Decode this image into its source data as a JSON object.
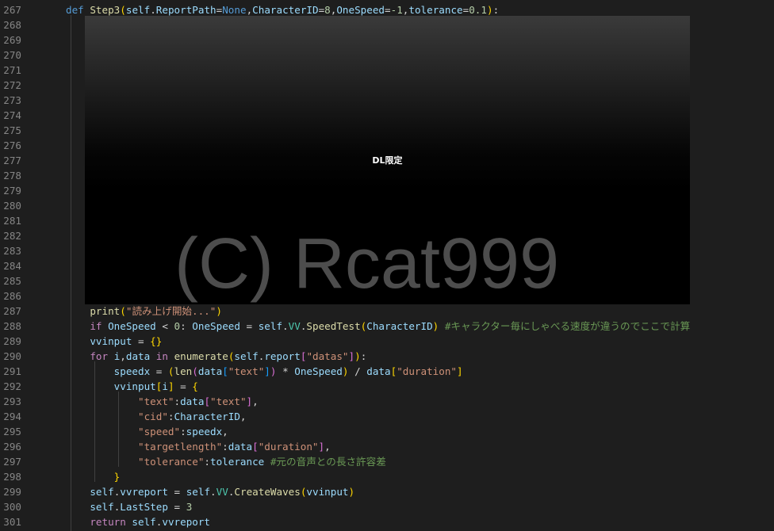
{
  "editor": {
    "lines": [
      {
        "n": "267",
        "tokens": [
          {
            "t": "def ",
            "c": "kw"
          },
          {
            "t": "Step3",
            "c": "fn"
          },
          {
            "t": "(",
            "c": "b1"
          },
          {
            "t": "self",
            "c": "var"
          },
          {
            "t": ".",
            "c": "pun"
          },
          {
            "t": "ReportPath",
            "c": "var"
          },
          {
            "t": "=",
            "c": "pun"
          },
          {
            "t": "None",
            "c": "kw"
          },
          {
            "t": ",",
            "c": "pun"
          },
          {
            "t": "CharacterID",
            "c": "var"
          },
          {
            "t": "=",
            "c": "pun"
          },
          {
            "t": "8",
            "c": "num"
          },
          {
            "t": ",",
            "c": "pun"
          },
          {
            "t": "OneSpeed",
            "c": "var"
          },
          {
            "t": "=",
            "c": "pun"
          },
          {
            "t": "-1",
            "c": "num"
          },
          {
            "t": ",",
            "c": "pun"
          },
          {
            "t": "tolerance",
            "c": "var"
          },
          {
            "t": "=",
            "c": "pun"
          },
          {
            "t": "0.1",
            "c": "num"
          },
          {
            "t": ")",
            "c": "b1"
          },
          {
            "t": ":",
            "c": "pun"
          }
        ]
      },
      {
        "n": "268",
        "tokens": []
      },
      {
        "n": "269",
        "tokens": []
      },
      {
        "n": "270",
        "tokens": []
      },
      {
        "n": "271",
        "tokens": []
      },
      {
        "n": "272",
        "tokens": []
      },
      {
        "n": "273",
        "tokens": []
      },
      {
        "n": "274",
        "tokens": []
      },
      {
        "n": "275",
        "tokens": []
      },
      {
        "n": "276",
        "tokens": []
      },
      {
        "n": "277",
        "tokens": []
      },
      {
        "n": "278",
        "tokens": []
      },
      {
        "n": "279",
        "tokens": []
      },
      {
        "n": "280",
        "tokens": []
      },
      {
        "n": "281",
        "tokens": []
      },
      {
        "n": "282",
        "tokens": []
      },
      {
        "n": "283",
        "tokens": []
      },
      {
        "n": "284",
        "tokens": []
      },
      {
        "n": "285",
        "tokens": []
      },
      {
        "n": "286",
        "tokens": []
      },
      {
        "n": "287",
        "tokens": [
          {
            "t": "    "
          },
          {
            "t": "print",
            "c": "fn"
          },
          {
            "t": "(",
            "c": "b1"
          },
          {
            "t": "\"読み上げ開始...\"",
            "c": "str"
          },
          {
            "t": ")",
            "c": "b1"
          }
        ]
      },
      {
        "n": "288",
        "tokens": [
          {
            "t": "    "
          },
          {
            "t": "if ",
            "c": "ctl"
          },
          {
            "t": "OneSpeed",
            "c": "var"
          },
          {
            "t": " < ",
            "c": "pun"
          },
          {
            "t": "0",
            "c": "num"
          },
          {
            "t": ": ",
            "c": "pun"
          },
          {
            "t": "OneSpeed",
            "c": "var"
          },
          {
            "t": " = ",
            "c": "pun"
          },
          {
            "t": "self",
            "c": "var"
          },
          {
            "t": ".",
            "c": "pun"
          },
          {
            "t": "VV",
            "c": "cls"
          },
          {
            "t": ".",
            "c": "pun"
          },
          {
            "t": "SpeedTest",
            "c": "fn"
          },
          {
            "t": "(",
            "c": "b1"
          },
          {
            "t": "CharacterID",
            "c": "var"
          },
          {
            "t": ")",
            "c": "b1"
          },
          {
            "t": " "
          },
          {
            "t": "#キャラクター毎にしゃべる速度が違うのでここで計算",
            "c": "cmt"
          }
        ]
      },
      {
        "n": "289",
        "tokens": [
          {
            "t": "    "
          },
          {
            "t": "vvinput",
            "c": "var"
          },
          {
            "t": " = ",
            "c": "pun"
          },
          {
            "t": "{}",
            "c": "b1"
          }
        ]
      },
      {
        "n": "290",
        "tokens": [
          {
            "t": "    "
          },
          {
            "t": "for ",
            "c": "ctl"
          },
          {
            "t": "i",
            "c": "var"
          },
          {
            "t": ",",
            "c": "pun"
          },
          {
            "t": "data",
            "c": "var"
          },
          {
            "t": " in ",
            "c": "ctl"
          },
          {
            "t": "enumerate",
            "c": "fn"
          },
          {
            "t": "(",
            "c": "b1"
          },
          {
            "t": "self",
            "c": "var"
          },
          {
            "t": ".",
            "c": "pun"
          },
          {
            "t": "report",
            "c": "var"
          },
          {
            "t": "[",
            "c": "b2"
          },
          {
            "t": "\"datas\"",
            "c": "str"
          },
          {
            "t": "]",
            "c": "b2"
          },
          {
            "t": ")",
            "c": "b1"
          },
          {
            "t": ":",
            "c": "pun"
          }
        ]
      },
      {
        "n": "291",
        "tokens": [
          {
            "t": "        "
          },
          {
            "t": "speedx",
            "c": "var"
          },
          {
            "t": " = ",
            "c": "pun"
          },
          {
            "t": "(",
            "c": "b1"
          },
          {
            "t": "len",
            "c": "fn"
          },
          {
            "t": "(",
            "c": "b2"
          },
          {
            "t": "data",
            "c": "var"
          },
          {
            "t": "[",
            "c": "b3"
          },
          {
            "t": "\"text\"",
            "c": "str"
          },
          {
            "t": "]",
            "c": "b3"
          },
          {
            "t": ")",
            "c": "b2"
          },
          {
            "t": " * ",
            "c": "pun"
          },
          {
            "t": "OneSpeed",
            "c": "var"
          },
          {
            "t": ")",
            "c": "b1"
          },
          {
            "t": " / ",
            "c": "pun"
          },
          {
            "t": "data",
            "c": "var"
          },
          {
            "t": "[",
            "c": "b1"
          },
          {
            "t": "\"duration\"",
            "c": "str"
          },
          {
            "t": "]",
            "c": "b1"
          }
        ]
      },
      {
        "n": "292",
        "tokens": [
          {
            "t": "        "
          },
          {
            "t": "vvinput",
            "c": "var"
          },
          {
            "t": "[",
            "c": "b1"
          },
          {
            "t": "i",
            "c": "var"
          },
          {
            "t": "]",
            "c": "b1"
          },
          {
            "t": " = ",
            "c": "pun"
          },
          {
            "t": "{",
            "c": "b1"
          }
        ]
      },
      {
        "n": "293",
        "tokens": [
          {
            "t": "            "
          },
          {
            "t": "\"text\"",
            "c": "str"
          },
          {
            "t": ":",
            "c": "pun"
          },
          {
            "t": "data",
            "c": "var"
          },
          {
            "t": "[",
            "c": "b2"
          },
          {
            "t": "\"text\"",
            "c": "str"
          },
          {
            "t": "]",
            "c": "b2"
          },
          {
            "t": ",",
            "c": "pun"
          }
        ]
      },
      {
        "n": "294",
        "tokens": [
          {
            "t": "            "
          },
          {
            "t": "\"cid\"",
            "c": "str"
          },
          {
            "t": ":",
            "c": "pun"
          },
          {
            "t": "CharacterID",
            "c": "var"
          },
          {
            "t": ",",
            "c": "pun"
          }
        ]
      },
      {
        "n": "295",
        "tokens": [
          {
            "t": "            "
          },
          {
            "t": "\"speed\"",
            "c": "str"
          },
          {
            "t": ":",
            "c": "pun"
          },
          {
            "t": "speedx",
            "c": "var"
          },
          {
            "t": ",",
            "c": "pun"
          }
        ]
      },
      {
        "n": "296",
        "tokens": [
          {
            "t": "            "
          },
          {
            "t": "\"targetlength\"",
            "c": "str"
          },
          {
            "t": ":",
            "c": "pun"
          },
          {
            "t": "data",
            "c": "var"
          },
          {
            "t": "[",
            "c": "b2"
          },
          {
            "t": "\"duration\"",
            "c": "str"
          },
          {
            "t": "]",
            "c": "b2"
          },
          {
            "t": ",",
            "c": "pun"
          }
        ]
      },
      {
        "n": "297",
        "tokens": [
          {
            "t": "            "
          },
          {
            "t": "\"tolerance\"",
            "c": "str"
          },
          {
            "t": ":",
            "c": "pun"
          },
          {
            "t": "tolerance",
            "c": "var"
          },
          {
            "t": " "
          },
          {
            "t": "#元の音声との長さ許容差",
            "c": "cmt"
          }
        ]
      },
      {
        "n": "298",
        "tokens": [
          {
            "t": "        "
          },
          {
            "t": "}",
            "c": "b1"
          }
        ]
      },
      {
        "n": "299",
        "tokens": [
          {
            "t": "    "
          },
          {
            "t": "self",
            "c": "var"
          },
          {
            "t": ".",
            "c": "pun"
          },
          {
            "t": "vvreport",
            "c": "var"
          },
          {
            "t": " = ",
            "c": "pun"
          },
          {
            "t": "self",
            "c": "var"
          },
          {
            "t": ".",
            "c": "pun"
          },
          {
            "t": "VV",
            "c": "cls"
          },
          {
            "t": ".",
            "c": "pun"
          },
          {
            "t": "CreateWaves",
            "c": "fn"
          },
          {
            "t": "(",
            "c": "b1"
          },
          {
            "t": "vvinput",
            "c": "var"
          },
          {
            "t": ")",
            "c": "b1"
          }
        ]
      },
      {
        "n": "300",
        "tokens": [
          {
            "t": "    "
          },
          {
            "t": "self",
            "c": "var"
          },
          {
            "t": ".",
            "c": "pun"
          },
          {
            "t": "LastStep",
            "c": "var"
          },
          {
            "t": " = ",
            "c": "pun"
          },
          {
            "t": "3",
            "c": "num"
          }
        ]
      },
      {
        "n": "301",
        "tokens": [
          {
            "t": "    "
          },
          {
            "t": "return ",
            "c": "ctl"
          },
          {
            "t": "self",
            "c": "var"
          },
          {
            "t": ".",
            "c": "pun"
          },
          {
            "t": "vvreport",
            "c": "var"
          }
        ]
      }
    ]
  },
  "overlay": {
    "label": "DL限定"
  },
  "watermark": {
    "text": "(C) Rcat999"
  }
}
